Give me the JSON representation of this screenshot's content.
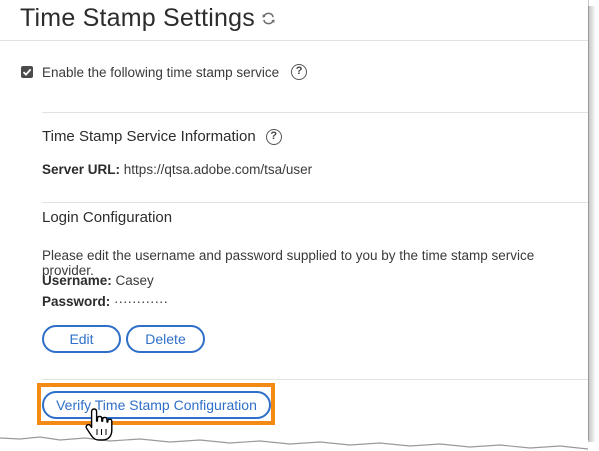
{
  "page": {
    "title": "Time Stamp Settings",
    "refresh_icon": "refresh-icon"
  },
  "enable": {
    "checked": true,
    "label": "Enable the following time stamp service",
    "help_icon": "help-icon",
    "help_glyph": "?"
  },
  "service_info": {
    "heading": "Time Stamp Service Information",
    "help_glyph": "?",
    "server_url_label": "Server URL:",
    "server_url_value": "https://qtsa.adobe.com/tsa/user"
  },
  "login": {
    "heading": "Login Configuration",
    "instructions": "Please edit the username and password supplied to you by the time stamp service provider.",
    "username_label": "Username:",
    "username_value": "Casey",
    "password_label": "Password:",
    "password_value": "············",
    "edit_label": "Edit",
    "delete_label": "Delete"
  },
  "verify": {
    "label": "Verify Time Stamp Configuration",
    "highlight_color": "#f28a13"
  },
  "colors": {
    "accent": "#2f6fc9",
    "text": "#3a3a3a",
    "divider": "#e2e2e2"
  }
}
